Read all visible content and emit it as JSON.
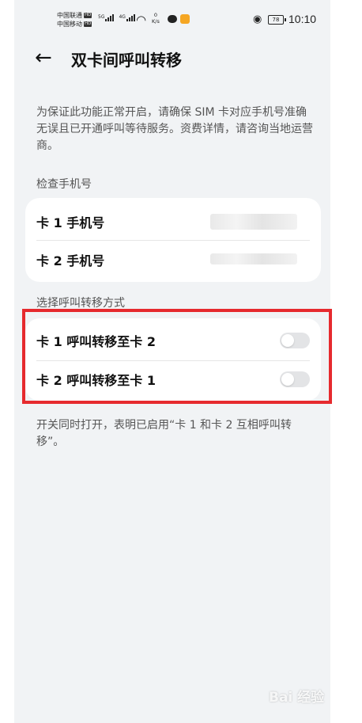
{
  "status_bar": {
    "carrier1": "中国联通",
    "carrier2": "中国移动",
    "hd": "HD",
    "net1": "5G",
    "net2": "4G",
    "speed_value": "0",
    "speed_unit": "K/s",
    "battery": "78",
    "time": "10:10"
  },
  "header": {
    "back_icon": "arrow-left",
    "title": "双卡间呼叫转移"
  },
  "description": "为保证此功能正常开启，请确保 SIM 卡对应手机号准确无误且已开通呼叫等待服务。资费详情，请咨询当地运营商。",
  "check_section": {
    "label": "检查手机号",
    "rows": [
      {
        "label": "卡 1 手机号"
      },
      {
        "label": "卡 2 手机号"
      }
    ]
  },
  "forward_section": {
    "label": "选择呼叫转移方式",
    "rows": [
      {
        "label": "卡 1 呼叫转移至卡 2",
        "enabled": false
      },
      {
        "label": "卡 2 呼叫转移至卡 1",
        "enabled": false
      }
    ]
  },
  "footnote": "开关同时打开，表明已启用“卡 1 和卡 2 互相呼叫转移”。",
  "colors": {
    "highlight": "#e62a2e",
    "background": "#f1f3f5",
    "card": "#ffffff"
  },
  "watermark": "Bai 经验"
}
